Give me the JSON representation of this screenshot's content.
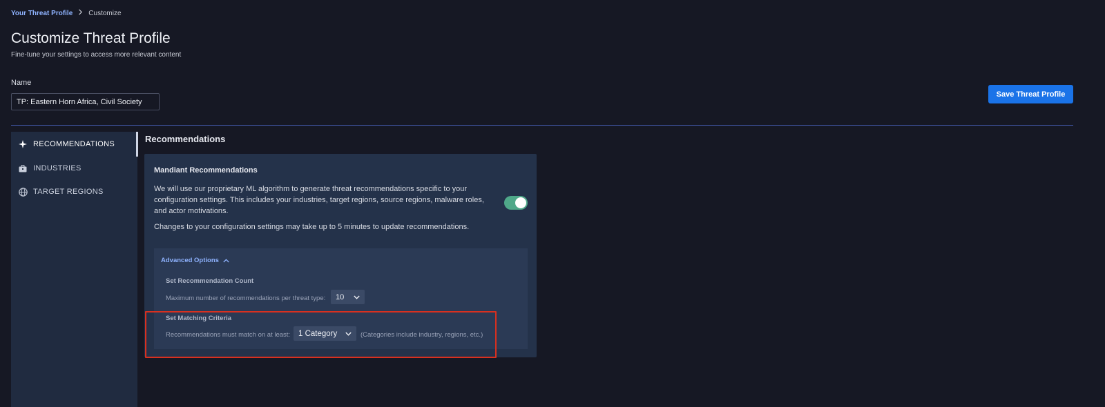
{
  "breadcrumb": {
    "parent": "Your Threat Profile",
    "separator_icon": "chevron-right-icon",
    "current": "Customize"
  },
  "header": {
    "title": "Customize Threat Profile",
    "subtitle": "Fine-tune your settings to access more relevant content"
  },
  "name_field": {
    "label": "Name",
    "value": "TP: Eastern Horn Africa, Civil Society"
  },
  "save_button": {
    "label": "Save Threat Profile",
    "color": "#1a73e8"
  },
  "sidebar": {
    "items": [
      {
        "label": "RECOMMENDATIONS",
        "icon": "sparkle-icon",
        "active": true
      },
      {
        "label": "INDUSTRIES",
        "icon": "briefcase-icon",
        "active": false
      },
      {
        "label": "TARGET REGIONS",
        "icon": "globe-icon",
        "active": false
      }
    ]
  },
  "main": {
    "heading": "Recommendations",
    "card": {
      "title": "Mandiant Recommendations",
      "description": "We will use our proprietary ML algorithm to generate threat recommendations specific to your configuration settings. This includes your industries, target regions, source regions, malware roles, and actor motivations.",
      "note": "Changes to your configuration settings may take up to 5 minutes to update recommendations.",
      "toggle_on": true,
      "toggle_color": "#4fa889",
      "advanced": {
        "label": "Advanced Options",
        "expanded": true,
        "count": {
          "title": "Set Recommendation Count",
          "text": "Maximum number of recommendations per threat type:",
          "value": "10"
        },
        "matching": {
          "title": "Set Matching Criteria",
          "text": "Recommendations must match on at least:",
          "value": "1 Category",
          "hint": "(Categories include industry, regions, etc.)"
        }
      }
    }
  },
  "highlight_color": "#d8301f"
}
